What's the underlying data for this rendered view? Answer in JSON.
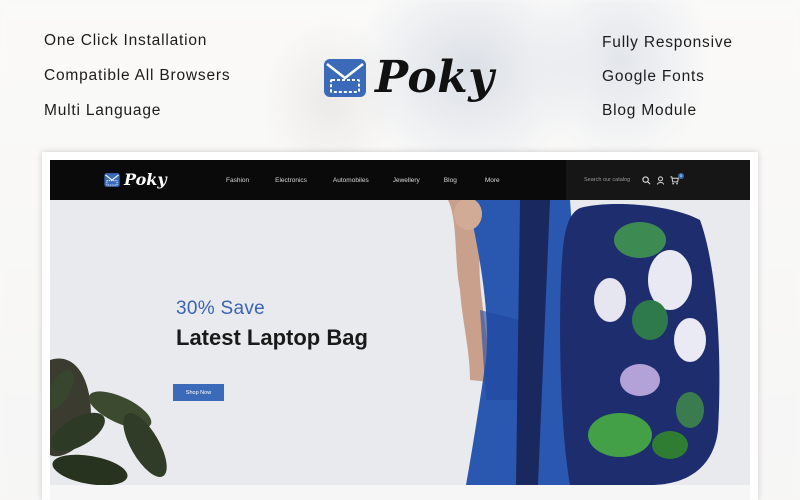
{
  "features_left": [
    "One Click Installation",
    "Compatible All Browsers",
    "Multi Language"
  ],
  "features_right": [
    "Fully Responsive",
    "Google Fonts",
    "Blog Module"
  ],
  "brand": {
    "name": "Poky",
    "accent": "#3a6ab8"
  },
  "store": {
    "logo": "Poky",
    "nav": [
      "Fashion",
      "Electronics",
      "Automobiles",
      "Jewellery",
      "Blog",
      "More"
    ],
    "search_placeholder": "Search our catalog",
    "cart_count": "0",
    "icons": [
      "search-icon",
      "user-icon",
      "cart-icon"
    ]
  },
  "hero": {
    "subtitle": "30% Save",
    "title": "Latest Laptop Bag",
    "button": "Shop Now"
  }
}
